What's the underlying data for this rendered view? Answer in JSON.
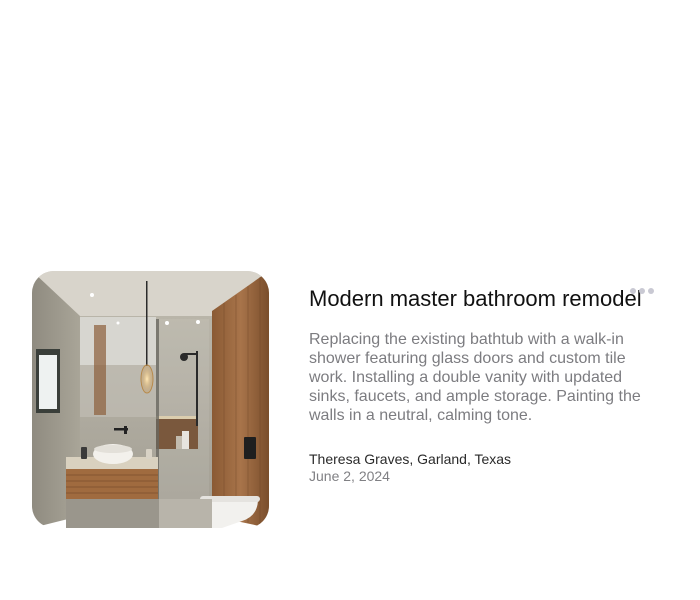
{
  "project": {
    "title": "Modern master bathroom remodel",
    "description": "Replacing the existing bathtub with a walk-in shower featuring glass doors and custom tile work. Installing a double vanity with updated sinks, faucets, and ample storage. Painting the walls in a neutral, calming tone.",
    "author": "Theresa Graves, Garland, Texas",
    "date": "June 2, 2024",
    "image_subject": "bathroom-render",
    "more_icon": "more-horizontal-icon"
  },
  "colors": {
    "title": "#111111",
    "description": "#7c7c80",
    "author": "#2a2a2a",
    "date": "#808084",
    "menu_dots": "#c9c9d3"
  }
}
